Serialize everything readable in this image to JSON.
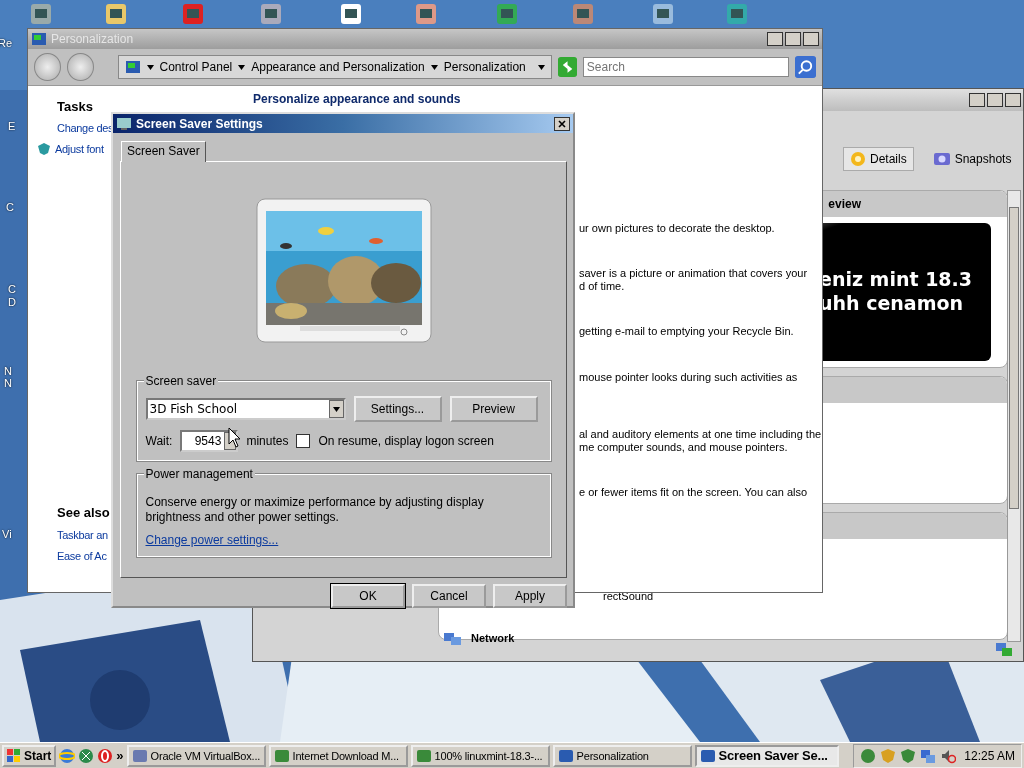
{
  "desktop": {
    "labels": [
      "Re",
      "E",
      "C",
      "C",
      "D",
      "N",
      "N",
      "Vi"
    ]
  },
  "back_window": {
    "toolbar": [
      {
        "label": "Details",
        "selected": true
      },
      {
        "label": "Snapshots",
        "selected": false
      }
    ],
    "preview_header": "eview",
    "preview_lines": [
      "eniz mint 18.3",
      "uhh cenamon"
    ],
    "fragment": "rectSound",
    "network_header": "Network"
  },
  "personalization": {
    "title": "Personalization",
    "breadcrumbs": [
      "Control Panel",
      "Appearance and Personalization",
      "Personalization"
    ],
    "search": {
      "placeholder": "Search"
    },
    "tasks": {
      "heading": "Tasks",
      "links": [
        {
          "label": "Change des",
          "kind": "plain"
        },
        {
          "label": "Adjust font",
          "kind": "shield"
        }
      ]
    },
    "see_also": {
      "heading": "See also",
      "links": [
        "Taskbar an",
        "Ease of Ac"
      ]
    },
    "heading": "Personalize appearance and sounds",
    "descriptions": [
      [
        "ur own pictures to decorate the desktop."
      ],
      [
        "saver is a picture or animation that covers your",
        "d of time."
      ],
      [
        "getting e-mail to emptying your Recycle Bin."
      ],
      [
        "mouse pointer looks during such activities as"
      ],
      [
        "al and auditory elements at one time including the",
        "me computer sounds, and mouse pointers."
      ],
      [
        "e or fewer items fit on the screen. You can also"
      ]
    ]
  },
  "dialog": {
    "title": "Screen Saver Settings",
    "tabs": [
      {
        "label": "Screen Saver",
        "selected": true
      }
    ],
    "screen_saver": {
      "legend": "Screen saver",
      "selection": "3D Fish School",
      "buttons": [
        "Settings...",
        "Preview"
      ],
      "wait_label": "Wait:",
      "wait_value": "9543",
      "minutes": "minutes",
      "logon": {
        "label": "On resume, display logon screen",
        "checked": false
      }
    },
    "power": {
      "legend": "Power management",
      "text": "Conserve energy or maximize performance by adjusting display brightness and other power settings.",
      "link": "Change power settings..."
    },
    "buttons": [
      "OK",
      "Cancel",
      "Apply"
    ]
  },
  "taskbar": {
    "start": "Start",
    "chevron": "»",
    "tasks": [
      {
        "label": "Oracle VM VirtualBox...",
        "selected": false
      },
      {
        "label": "Internet Download M...",
        "selected": false
      },
      {
        "label": "100% linuxmint-18.3-...",
        "selected": false
      },
      {
        "label": "Personalization",
        "selected": false
      },
      {
        "label": "Screen Saver Se...",
        "selected": true
      }
    ],
    "clock": "12:25 AM"
  }
}
